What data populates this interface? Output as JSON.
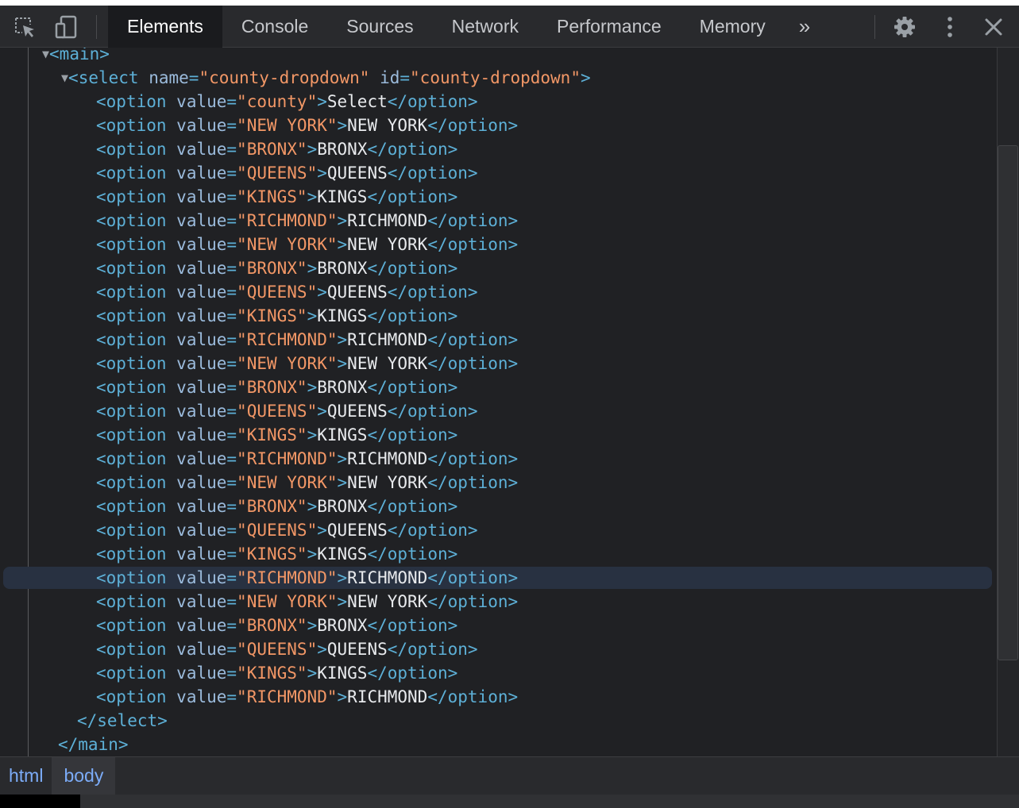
{
  "toolbar": {
    "icons": [
      "inspect-element-icon",
      "device-toolbar-icon",
      "settings-gear-icon",
      "more-options-icon",
      "close-icon"
    ],
    "tabs": [
      {
        "label": "Elements",
        "active": true
      },
      {
        "label": "Console"
      },
      {
        "label": "Sources"
      },
      {
        "label": "Network"
      },
      {
        "label": "Performance"
      },
      {
        "label": "Memory"
      }
    ],
    "more_tabs_label": "»"
  },
  "dom": {
    "main_open_tag": "<main>",
    "select_tag_name": "select",
    "select_name_attr": "name",
    "select_name_value": "county-dropdown",
    "select_id_attr": "id",
    "select_id_value": "county-dropdown",
    "option_tag": "option",
    "option_value_attr": "value",
    "options": [
      {
        "value": "county",
        "text": "Select"
      },
      {
        "value": "NEW YORK",
        "text": "NEW YORK"
      },
      {
        "value": "BRONX",
        "text": "BRONX"
      },
      {
        "value": "QUEENS",
        "text": "QUEENS"
      },
      {
        "value": "KINGS",
        "text": "KINGS"
      },
      {
        "value": "RICHMOND",
        "text": "RICHMOND"
      },
      {
        "value": "NEW YORK",
        "text": "NEW YORK"
      },
      {
        "value": "BRONX",
        "text": "BRONX"
      },
      {
        "value": "QUEENS",
        "text": "QUEENS"
      },
      {
        "value": "KINGS",
        "text": "KINGS"
      },
      {
        "value": "RICHMOND",
        "text": "RICHMOND"
      },
      {
        "value": "NEW YORK",
        "text": "NEW YORK"
      },
      {
        "value": "BRONX",
        "text": "BRONX"
      },
      {
        "value": "QUEENS",
        "text": "QUEENS"
      },
      {
        "value": "KINGS",
        "text": "KINGS"
      },
      {
        "value": "RICHMOND",
        "text": "RICHMOND"
      },
      {
        "value": "NEW YORK",
        "text": "NEW YORK"
      },
      {
        "value": "BRONX",
        "text": "BRONX"
      },
      {
        "value": "QUEENS",
        "text": "QUEENS"
      },
      {
        "value": "KINGS",
        "text": "KINGS"
      },
      {
        "value": "RICHMOND",
        "text": "RICHMOND",
        "highlighted": true
      },
      {
        "value": "NEW YORK",
        "text": "NEW YORK"
      },
      {
        "value": "BRONX",
        "text": "BRONX"
      },
      {
        "value": "QUEENS",
        "text": "QUEENS"
      },
      {
        "value": "KINGS",
        "text": "KINGS"
      },
      {
        "value": "RICHMOND",
        "text": "RICHMOND"
      }
    ],
    "select_close_tag": "</select>",
    "main_close_tag": "</main>"
  },
  "breadcrumbs": [
    {
      "label": "html"
    },
    {
      "label": "body",
      "active": true
    }
  ],
  "colors": {
    "background": "#202124",
    "tag": "#5db0d7",
    "attribute_name": "#9bbbdc",
    "attribute_value": "#f29766",
    "text_node": "#e8eaed",
    "selected_row": "#283141"
  }
}
